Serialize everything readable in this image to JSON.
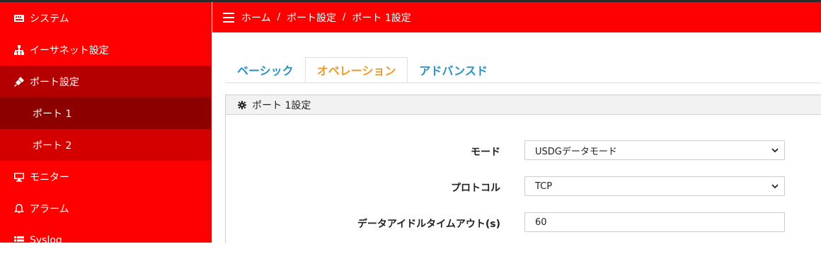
{
  "sidebar": {
    "items": [
      {
        "label": "システム",
        "icon": "system-icon"
      },
      {
        "label": "イーサネット設定",
        "icon": "network-icon"
      },
      {
        "label": "ポート設定",
        "icon": "plug-icon"
      },
      {
        "label": "ポート 1"
      },
      {
        "label": "ポート 2"
      },
      {
        "label": "モニター",
        "icon": "monitor-icon"
      },
      {
        "label": "アラーム",
        "icon": "bell-icon"
      },
      {
        "label": "Syslog",
        "icon": "list-icon"
      }
    ]
  },
  "header": {
    "breadcrumb": [
      "ホーム",
      "ポート設定",
      "ポート 1設定"
    ],
    "separator": "/"
  },
  "tabs": [
    {
      "label": "ベーシック",
      "active": false
    },
    {
      "label": "オペレーション",
      "active": true
    },
    {
      "label": "アドバンスド",
      "active": false
    }
  ],
  "panel": {
    "title": "ポート 1設定",
    "fields": [
      {
        "label": "モード",
        "type": "select",
        "value": "USDGデータモード"
      },
      {
        "label": "プロトコル",
        "type": "select",
        "value": "TCP"
      },
      {
        "label": "データアイドルタイムアウト(s)",
        "type": "input",
        "value": "60"
      }
    ]
  },
  "colors": {
    "sidebar_bg": "#ff0000",
    "sidebar_active": "#b40000",
    "sidebar_sub": "#d40000",
    "sidebar_current": "#8c0000",
    "tab_active": "#f09a2a",
    "tab_inactive": "#2a91c4"
  }
}
